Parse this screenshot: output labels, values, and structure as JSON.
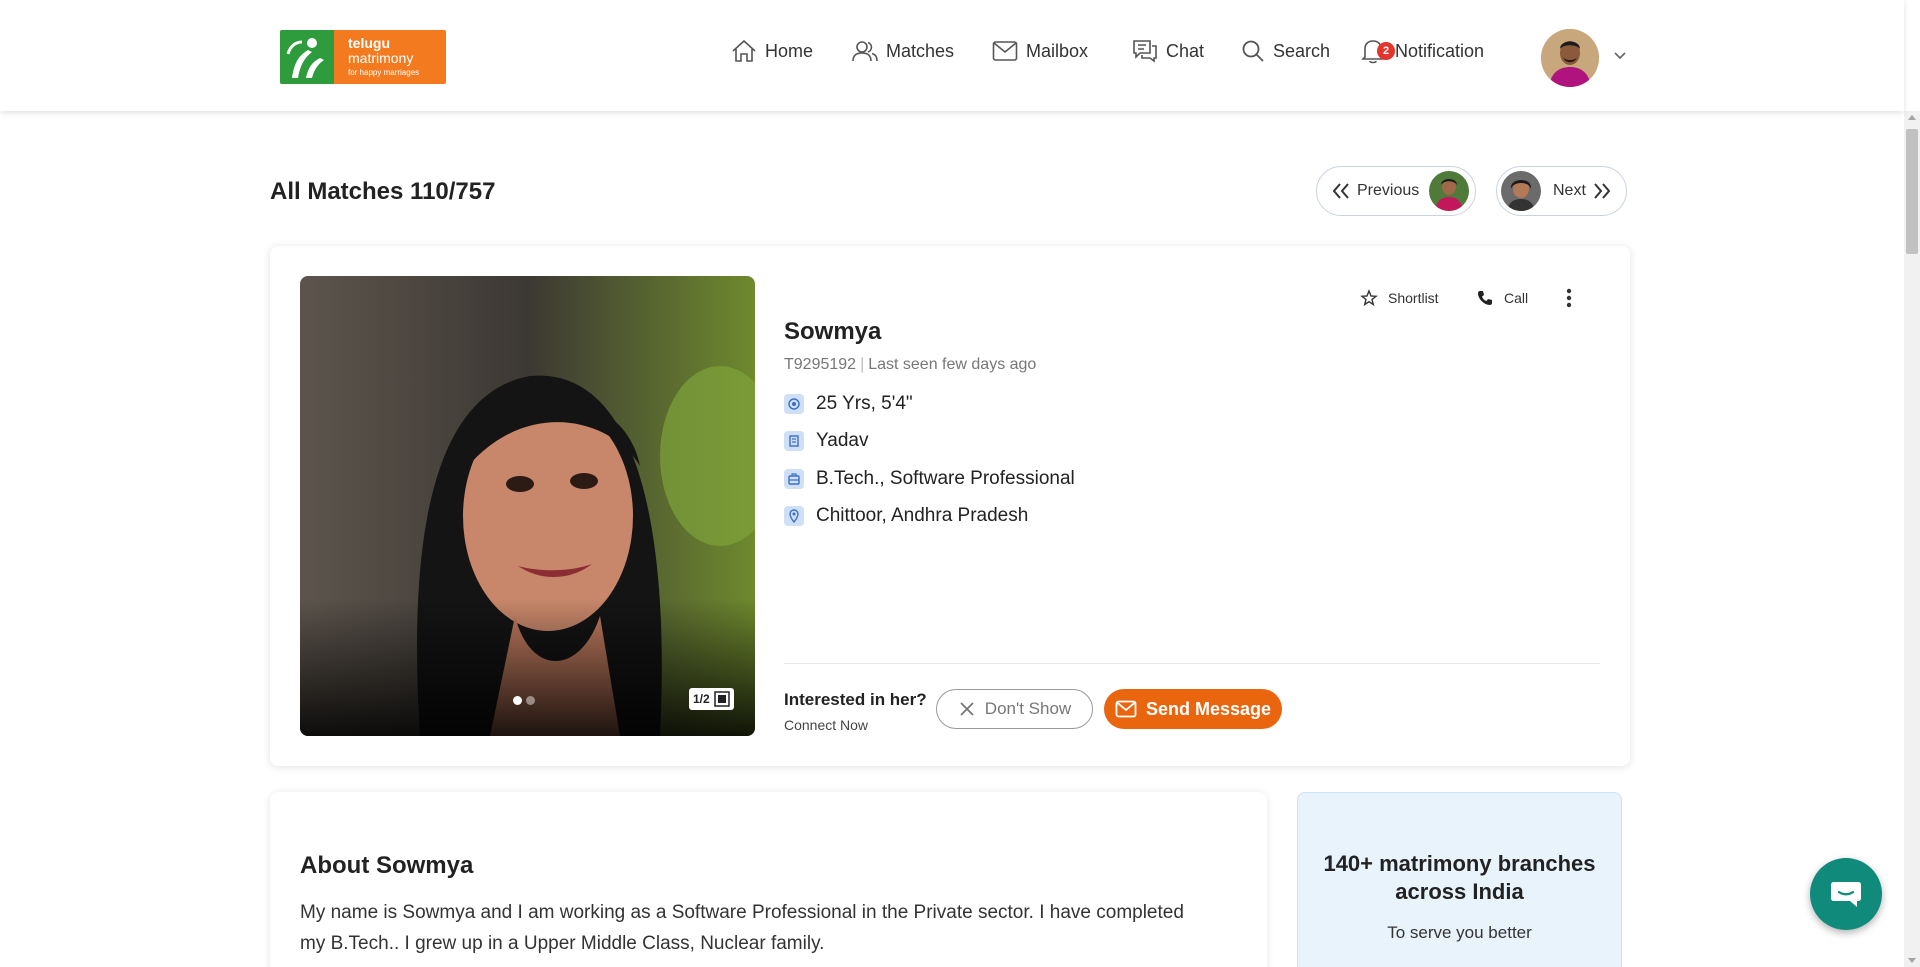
{
  "brand": {
    "line1": "telugu",
    "line2": "matrimony",
    "tagline": "for happy marriages",
    "colors": {
      "orange": "#f47a20",
      "green": "#2e9c3c"
    }
  },
  "nav": {
    "home": "Home",
    "matches": "Matches",
    "mailbox": "Mailbox",
    "chat": "Chat",
    "search": "Search",
    "notification": "Notification",
    "notification_count": "2"
  },
  "page": {
    "title": "All Matches 110/757",
    "previous": "Previous",
    "next": "Next"
  },
  "profile": {
    "name": "Sowmya",
    "id": "T9295192",
    "last_seen": "Last seen few days ago",
    "age_height": "25 Yrs, 5'4\"",
    "caste": "Yadav",
    "education_job": "B.Tech., Software Professional",
    "location": "Chittoor, Andhra Pradesh",
    "photo_counter": "1/2",
    "photo_count": 2,
    "photo_index": 1
  },
  "actions": {
    "shortlist": "Shortlist",
    "call": "Call",
    "more_icon": "more-vertical-icon"
  },
  "interest": {
    "question": "Interested in her?",
    "sub": "Connect Now",
    "dont_show": "Don't Show",
    "send_message": "Send Message",
    "accent": "#e9650e"
  },
  "about": {
    "title": "About Sowmya",
    "text": "My name is Sowmya and I am working as a Software Professional in the Private sector. I have completed my B.Tech.. I grew up in a Upper Middle Class, Nuclear family."
  },
  "branches": {
    "title": "140+ matrimony branches across India",
    "sub": "To serve you better"
  }
}
